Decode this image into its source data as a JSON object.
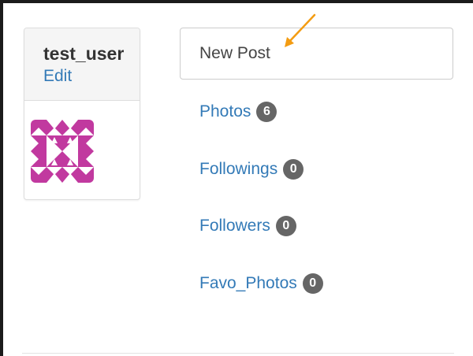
{
  "profile": {
    "username": "test_user",
    "edit_label": "Edit"
  },
  "new_post": {
    "label": "New Post"
  },
  "stats": [
    {
      "label": "Photos",
      "count": "6"
    },
    {
      "label": "Followings",
      "count": "0"
    },
    {
      "label": "Followers",
      "count": "0"
    },
    {
      "label": "Favo_Photos",
      "count": "0"
    }
  ],
  "colors": {
    "link": "#337ab7",
    "badge": "#666666",
    "avatar": "#c1399f",
    "arrow": "#f39c12"
  },
  "icons": {
    "avatar": "identicon-avatar",
    "arrow": "annotation-arrow-icon"
  }
}
